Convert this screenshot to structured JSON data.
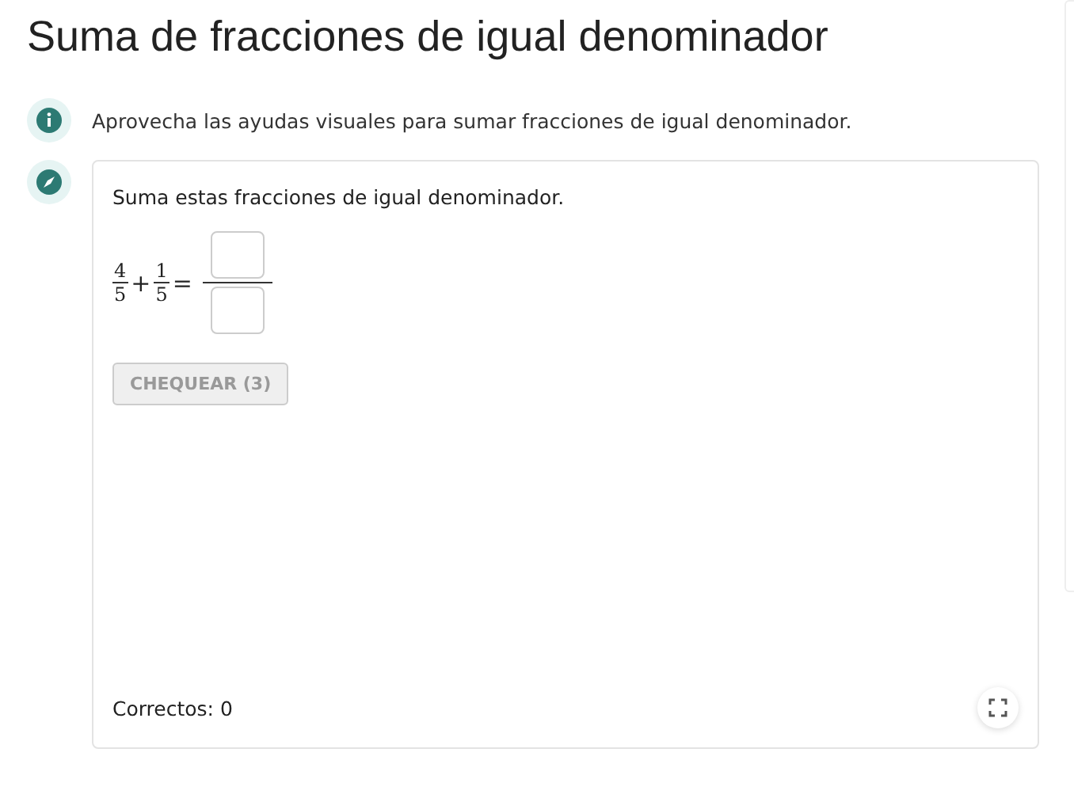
{
  "title": "Suma de fracciones de igual denominador",
  "info": {
    "text": "Aprovecha las ayudas visuales para sumar fracciones de igual denominador."
  },
  "exercise": {
    "prompt": "Suma estas fracciones de igual denominador.",
    "terms": [
      {
        "numerator": "4",
        "denominator": "5"
      },
      {
        "numerator": "1",
        "denominator": "5"
      }
    ],
    "plus": "+",
    "equals": "=",
    "check_button": {
      "label": "CHEQUEAR (3)",
      "disabled": true
    },
    "score": "Correctos: 0"
  }
}
